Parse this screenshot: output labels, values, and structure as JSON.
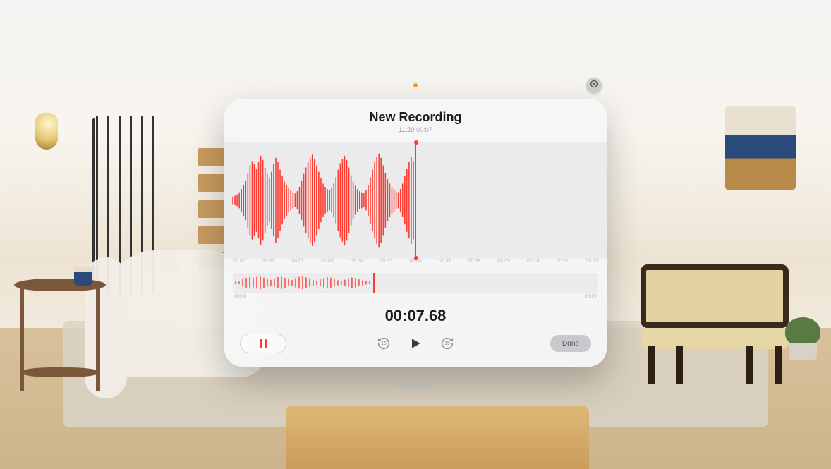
{
  "header": {
    "title": "New Recording",
    "time_of_day": "11:20",
    "duration_short": "00:07"
  },
  "waveform": {
    "timeline_ticks": [
      "00:00",
      "00:01",
      "00:02",
      "00:03",
      "00:04",
      "00:05",
      "00:06",
      "00:07",
      "00:08",
      "00:09",
      "00:10",
      "00:11",
      "00:12"
    ],
    "mini_start": "00:00",
    "mini_end": "00:20",
    "mini_cursor_ratio": 0.384,
    "main": [
      0.06,
      0.08,
      0.1,
      0.14,
      0.2,
      0.28,
      0.36,
      0.5,
      0.64,
      0.72,
      0.66,
      0.58,
      0.7,
      0.82,
      0.74,
      0.6,
      0.48,
      0.4,
      0.52,
      0.66,
      0.78,
      0.7,
      0.56,
      0.44,
      0.34,
      0.28,
      0.22,
      0.18,
      0.14,
      0.12,
      0.16,
      0.24,
      0.36,
      0.48,
      0.6,
      0.7,
      0.78,
      0.84,
      0.76,
      0.64,
      0.52,
      0.4,
      0.3,
      0.24,
      0.2,
      0.18,
      0.22,
      0.3,
      0.42,
      0.56,
      0.68,
      0.76,
      0.82,
      0.74,
      0.6,
      0.46,
      0.34,
      0.26,
      0.2,
      0.16,
      0.14,
      0.12,
      0.18,
      0.28,
      0.42,
      0.56,
      0.7,
      0.8,
      0.86,
      0.78,
      0.64,
      0.5,
      0.38,
      0.3,
      0.24,
      0.2,
      0.16,
      0.14,
      0.2,
      0.3,
      0.44,
      0.58,
      0.7,
      0.8,
      0.72
    ],
    "mini": [
      0.12,
      0.1,
      0.4,
      0.55,
      0.6,
      0.5,
      0.66,
      0.72,
      0.58,
      0.42,
      0.3,
      0.45,
      0.62,
      0.7,
      0.55,
      0.38,
      0.28,
      0.5,
      0.66,
      0.74,
      0.6,
      0.44,
      0.3,
      0.2,
      0.35,
      0.5,
      0.64,
      0.56,
      0.4,
      0.26,
      0.18,
      0.32,
      0.48,
      0.6,
      0.52,
      0.36,
      0.24,
      0.16,
      0.1
    ]
  },
  "time_display": "00:07.68",
  "controls": {
    "skip_back_seconds": "15",
    "skip_fwd_seconds": "15",
    "done_label": "Done"
  },
  "colors": {
    "accent": "#ff3b30"
  }
}
